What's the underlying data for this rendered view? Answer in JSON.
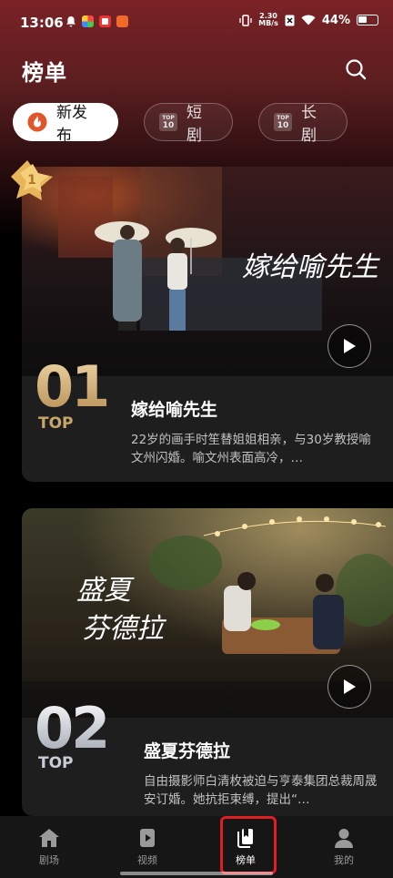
{
  "status_bar": {
    "time": "13:06",
    "net_speed_value": "2.30",
    "net_speed_unit": "MB/s",
    "battery": "44%"
  },
  "header": {
    "title": "榜单"
  },
  "tabs": [
    {
      "label": "新发布",
      "active": true
    },
    {
      "label": "短剧",
      "active": false,
      "badge": [
        "TOP",
        "10"
      ]
    },
    {
      "label": "长剧",
      "active": false,
      "badge": [
        "TOP",
        "10"
      ]
    }
  ],
  "rank_badge": "1",
  "cards": [
    {
      "rank": "01",
      "rank_suffix": "TOP",
      "title": "嫁给喻先生",
      "poster_text": "嫁给喻先生",
      "description": "22岁的画手时笙替姐姐相亲，与30岁教授喻文州闪婚。喻文州表面高冷，…"
    },
    {
      "rank": "02",
      "rank_suffix": "TOP",
      "title": "盛夏芬德拉",
      "poster_text_line1": "盛夏",
      "poster_text_line2": "芬德拉",
      "description": "自由摄影师白清枚被迫与亨泰集团总裁周晟安订婚。她抗拒束缚，提出“…"
    }
  ],
  "bottom_nav": [
    {
      "label": "剧场",
      "active": false
    },
    {
      "label": "视频",
      "active": false
    },
    {
      "label": "榜单",
      "active": true
    },
    {
      "label": "我的",
      "active": false
    }
  ],
  "colors": {
    "accent_red": "#e01c24",
    "header_gradient_top": "#7a2226",
    "rank_gold": "#c8a66a"
  }
}
